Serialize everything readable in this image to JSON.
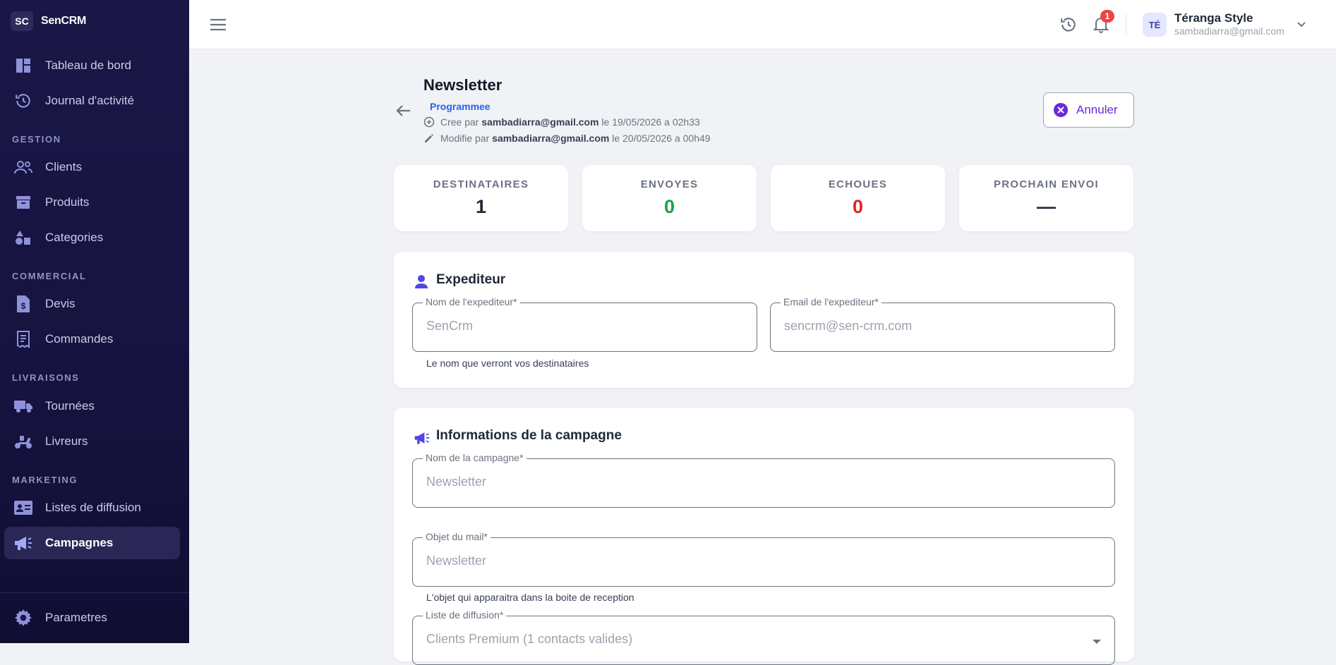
{
  "app": {
    "badge": "SC",
    "name": "SenCRM"
  },
  "sidebar": {
    "top_items": [
      {
        "label": "Tableau de bord"
      },
      {
        "label": "Journal d'activité"
      }
    ],
    "sections": [
      {
        "title": "GESTION",
        "items": [
          {
            "label": "Clients"
          },
          {
            "label": "Produits"
          },
          {
            "label": "Categories"
          }
        ]
      },
      {
        "title": "COMMERCIAL",
        "items": [
          {
            "label": "Devis"
          },
          {
            "label": "Commandes"
          }
        ]
      },
      {
        "title": "LIVRAISONS",
        "items": [
          {
            "label": "Tournées"
          },
          {
            "label": "Livreurs"
          }
        ]
      },
      {
        "title": "MARKETING",
        "items": [
          {
            "label": "Listes de diffusion"
          },
          {
            "label": "Campagnes"
          }
        ]
      }
    ],
    "bottom_item": {
      "label": "Parametres"
    },
    "active": "Campagnes"
  },
  "topbar": {
    "notification_count": "1",
    "user": {
      "initials": "TÉ",
      "name": "Téranga Style",
      "email": "sambadiarra@gmail.com"
    }
  },
  "header": {
    "title": "Newsletter",
    "status": "Programmee",
    "created_prefix": "Cree par",
    "created_by": "sambadiarra@gmail.com",
    "created_suffix": "le 19/05/2026 a 02h33",
    "modified_prefix": "Modifie par",
    "modified_by": "sambadiarra@gmail.com",
    "modified_suffix": "le 20/05/2026 a 00h49",
    "cancel_label": "Annuler"
  },
  "stats": [
    {
      "label": "DESTINATAIRES",
      "value": "1",
      "color": "#1f2937"
    },
    {
      "label": "ENVOYES",
      "value": "0",
      "color": "#16a34a"
    },
    {
      "label": "ECHOUES",
      "value": "0",
      "color": "#dc2626"
    },
    {
      "label": "PROCHAIN ENVOI",
      "value": "—",
      "color": "#1f2937"
    }
  ],
  "sender": {
    "title": "Expediteur",
    "name_label": "Nom de l'expediteur",
    "name_value": "SenCrm",
    "name_helper": "Le nom que verront vos destinataires",
    "email_label": "Email de l'expediteur",
    "email_value": "sencrm@sen-crm.com"
  },
  "campaign": {
    "title": "Informations de la campagne",
    "name_label": "Nom de la campagne",
    "name_value": "Newsletter",
    "subject_label": "Objet du mail",
    "subject_value": "Newsletter",
    "subject_helper": "L'objet qui apparaitra dans la boite de reception",
    "list_label": "Liste de diffusion",
    "list_value": "Clients Premium (1 contacts valides)"
  },
  "required_mark": "*"
}
